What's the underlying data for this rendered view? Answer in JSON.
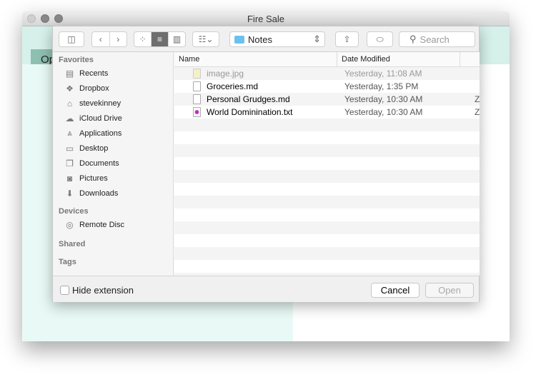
{
  "window": {
    "title": "Fire Sale",
    "open_button": "Op"
  },
  "toolbar": {
    "location": "Notes",
    "search_placeholder": "Search"
  },
  "sidebar": {
    "favorites_header": "Favorites",
    "favorites": [
      {
        "label": "Recents",
        "icon": "▤"
      },
      {
        "label": "Dropbox",
        "icon": "❖"
      },
      {
        "label": "stevekinney",
        "icon": "⌂"
      },
      {
        "label": "iCloud Drive",
        "icon": "☁"
      },
      {
        "label": "Applications",
        "icon": "⩓"
      },
      {
        "label": "Desktop",
        "icon": "▭"
      },
      {
        "label": "Documents",
        "icon": "❐"
      },
      {
        "label": "Pictures",
        "icon": "◙"
      },
      {
        "label": "Downloads",
        "icon": "⬇"
      }
    ],
    "devices_header": "Devices",
    "devices": [
      {
        "label": "Remote Disc",
        "icon": "◎"
      }
    ],
    "shared_header": "Shared",
    "tags_header": "Tags"
  },
  "list": {
    "columns": [
      "Name",
      "Date Modified"
    ],
    "rows": [
      {
        "name": "image.jpg",
        "date": "Yesterday, 11:08 AM",
        "kind": "",
        "disabled": true
      },
      {
        "name": "Groceries.md",
        "date": "Yesterday, 1:35 PM",
        "kind": ""
      },
      {
        "name": "Personal Grudges.md",
        "date": "Yesterday, 10:30 AM",
        "kind": "Z"
      },
      {
        "name": "World Dominination.txt",
        "date": "Yesterday, 10:30 AM",
        "kind": "Z"
      }
    ]
  },
  "bottom": {
    "hide_extension": "Hide extension",
    "cancel": "Cancel",
    "open": "Open"
  }
}
